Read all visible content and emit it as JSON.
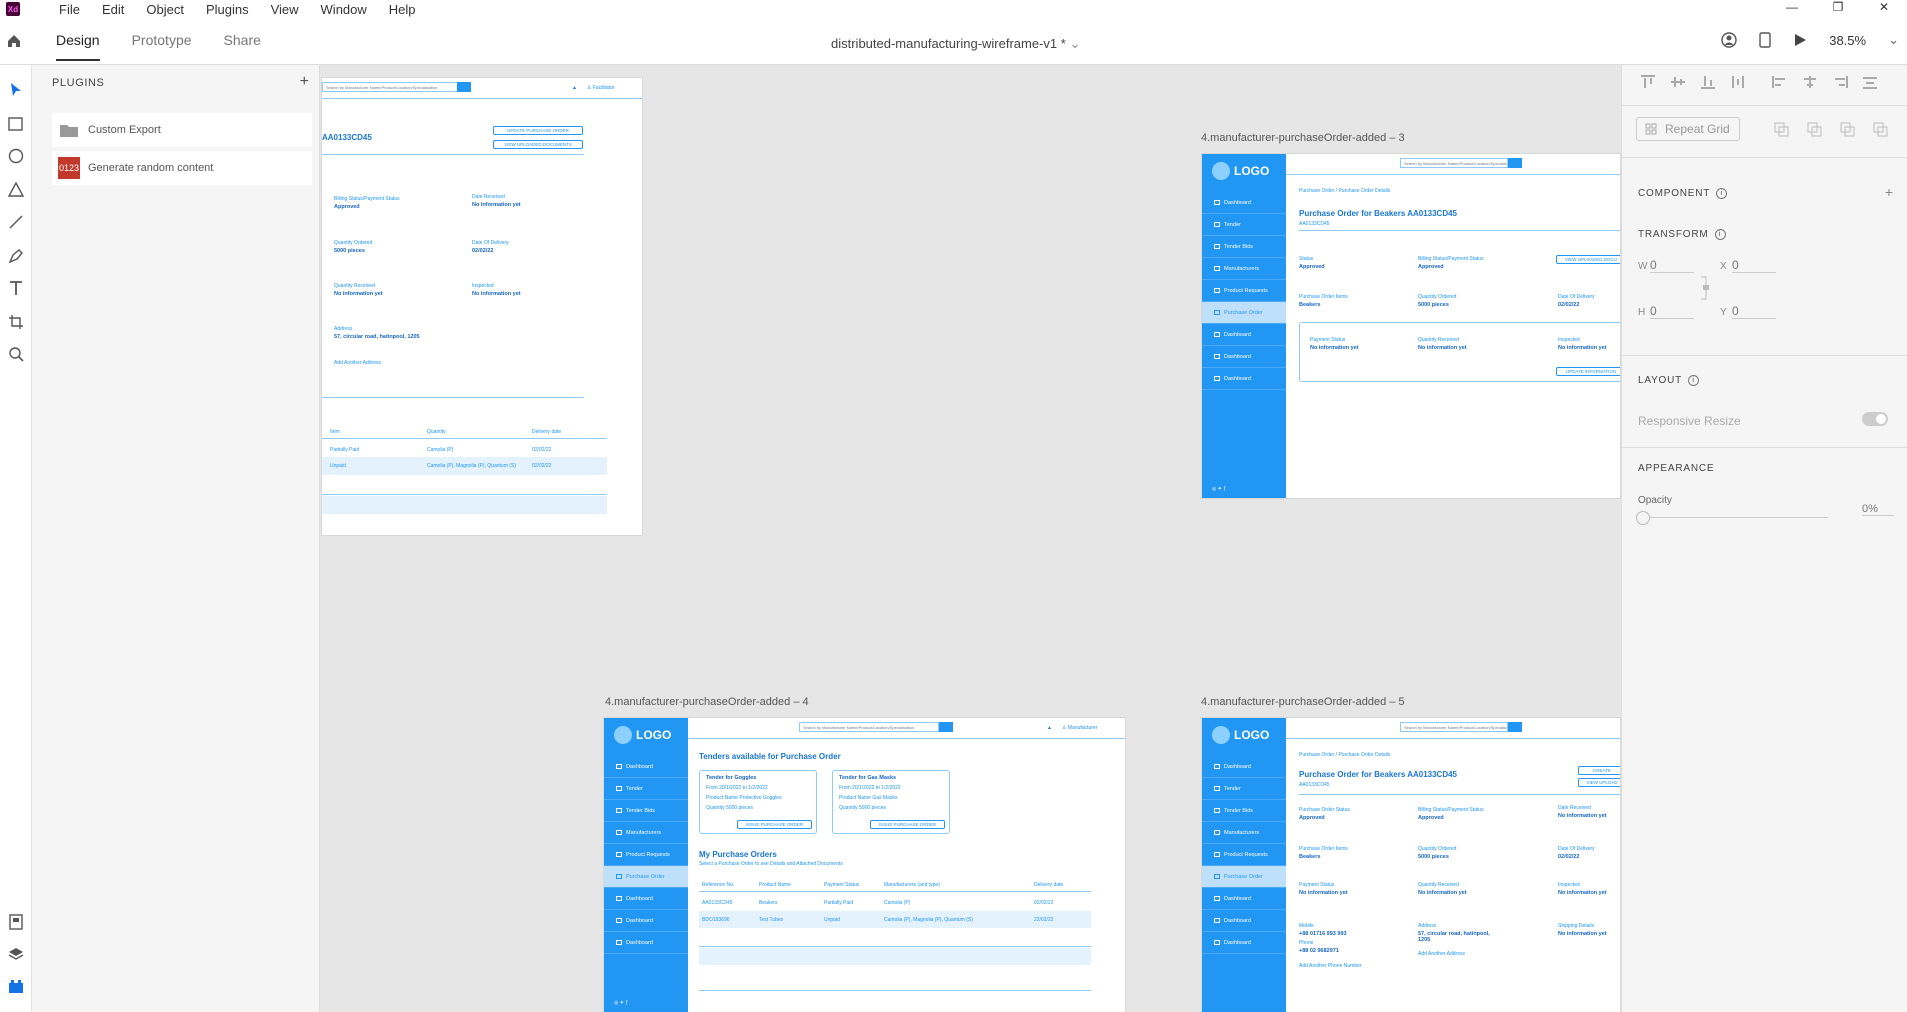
{
  "app": {
    "logo": "Xd",
    "menu": [
      "File",
      "Edit",
      "Object",
      "Plugins",
      "View",
      "Window",
      "Help"
    ],
    "window_controls": [
      "—",
      "❐",
      "✕"
    ]
  },
  "toolbar": {
    "tabs": [
      "Design",
      "Prototype",
      "Share"
    ],
    "document_title": "distributed-manufacturing-wireframe-v1 *",
    "zoom": "38.5%"
  },
  "plugins": {
    "header": "PLUGINS",
    "items": [
      {
        "label": "Custom Export",
        "icon": "folder-icon"
      },
      {
        "label": "Generate random content",
        "icon": "random-content-icon",
        "badge": "0123"
      }
    ]
  },
  "props": {
    "repeat_grid": "Repeat Grid",
    "component": "COMPONENT",
    "transform": "TRANSFORM",
    "w_label": "W",
    "w_value": "0",
    "x_label": "X",
    "x_value": "0",
    "h_label": "H",
    "h_value": "0",
    "y_label": "Y",
    "y_value": "0",
    "layout": "LAYOUT",
    "responsive_resize": "Responsive Resize",
    "appearance": "APPEARANCE",
    "opacity_label": "Opacity",
    "opacity_value": "0%"
  },
  "artboards": {
    "ab1": {
      "search_placeholder": "Search by Manufacturer Name/Product/Location/Specialization",
      "user": "Facilitator",
      "id_title": "AA0133CD45",
      "btn_update": "UPDATE PURCHASE ORDER",
      "btn_view": "VIEW UPLOADED DOCUMENTS",
      "fields": [
        {
          "label": "Billing Status/Payment Status",
          "value": "Approved"
        },
        {
          "label": "Date Received",
          "value": "No information yet"
        },
        {
          "label": "Quantity Ordered",
          "value": "5000 pieces"
        },
        {
          "label": "Date Of Delivery",
          "value": "02/02/22"
        },
        {
          "label": "Quantity Received",
          "value": "No information yet"
        },
        {
          "label": "Inspected",
          "value": "No information yet"
        }
      ],
      "address_label": "Address",
      "address_value": "57, circular road, hatinpool, 1205",
      "add_address": "Add Another Address",
      "table_headers": [
        "Item",
        "Quantity",
        "Delivery date"
      ],
      "rows": [
        [
          "Partially Paid",
          "Camolia (P)",
          "02/02/22"
        ],
        [
          "Unpaid",
          "Camolia (P), Magnolia (P), Quantum (S)",
          "02/02/22"
        ]
      ]
    },
    "ab3": {
      "label": "4.manufacturer-purchaseOrder-added – 3",
      "logo": "LOGO",
      "search_placeholder": "Search by Manufacturer Name/Product/Location/Specialization",
      "nav": [
        "Dashboard",
        "Tender",
        "Tender Bids",
        "Manufacturers",
        "Product Requests",
        "Purchase Order",
        "Dashboard",
        "Dashboard",
        "Dashboard"
      ],
      "breadcrumb": "Purchase Order  /  Purchase Order Details",
      "title": "Purchase Order for Beakers AA0133CD45",
      "subtitle": "AA0133CD45",
      "fields": [
        {
          "label": "Status",
          "value": "Approved"
        },
        {
          "label": "Billing Status/Payment Status",
          "value": "Approved"
        },
        {
          "label": "Purchase Order Items",
          "value": "Beakers"
        },
        {
          "label": "Quantity Ordered",
          "value": "5000 pieces"
        },
        {
          "label": "Date Of Delivery",
          "value": "02/02/22"
        }
      ],
      "box_fields": [
        {
          "label": "Payment Status",
          "value": "No information yet"
        },
        {
          "label": "Quantity Received",
          "value": "No information yet"
        },
        {
          "label": "Inspected",
          "value": "No information yet"
        }
      ],
      "btn_view": "VIEW UPLOADED DOCU",
      "btn_update": "UPDATE INFORMATION"
    },
    "ab4": {
      "label": "4.manufacturer-purchaseOrder-added – 4",
      "logo": "LOGO",
      "search_placeholder": "Search by Manufacturer Name/Product/Location/Specialization",
      "user": "Manufacturer",
      "nav": [
        "Dashboard",
        "Tender",
        "Tender Bids",
        "Manufacturers",
        "Product Requests",
        "Purchase Order",
        "Dashboard",
        "Dashboard",
        "Dashboard"
      ],
      "tenders_title": "Tenders available for Purchase Order",
      "tenders": [
        {
          "title": "Tender for Goggles",
          "from": "From 20/1/2022 to 1/2/2022",
          "product": "Product Name Protective Goggles",
          "qty": "Quantity 5000 pieces",
          "btn": "ISSUE PURCHASE ORDER"
        },
        {
          "title": "Tender for Gas Masks",
          "from": "From 20/1/2022 to 1/2/2022",
          "product": "Product Name Gas Masks",
          "qty": "Quantity 5000 pieces",
          "btn": "ISSUE PURCHASE ORDER"
        }
      ],
      "my_orders_title": "My Purchase Orders",
      "my_orders_sub": "Select a Purchase Order to see Details and Attached Documents",
      "table_headers": [
        "Reference No.",
        "Product Name",
        "Payment Status",
        "Manufacturers (and type)",
        "Delivery date"
      ],
      "rows": [
        [
          "AA0133CD45",
          "Beakers",
          "Partially Paid",
          "Camolia (P)",
          "02/02/22"
        ],
        [
          "BDO193696",
          "Test Tubes",
          "Unpaid",
          "Camolia (P), Magnolia (P), Quantum (S)",
          "22/02/22"
        ]
      ]
    },
    "ab5": {
      "label": "4.manufacturer-purchaseOrder-added – 5",
      "logo": "LOGO",
      "search_placeholder": "Search by Manufacturer Name/Product/Location/Specialization",
      "nav": [
        "Dashboard",
        "Tender",
        "Tender Bids",
        "Manufacturers",
        "Product Requests",
        "Purchase Order",
        "Dashboard",
        "Dashboard",
        "Dashboard"
      ],
      "breadcrumb": "Purchase Order  /  Purchase Order Details",
      "title": "Purchase Order for Beakers AA0133CD45",
      "subtitle": "AA0133CD45",
      "btn_create": "CREATE",
      "btn_view": "VIEW UPLOAD",
      "fields": [
        {
          "label": "Purchase Order Status",
          "value": "Approved"
        },
        {
          "label": "Billing Status/Payment Status",
          "value": "Approved"
        },
        {
          "label": "Date Received",
          "value": "No information yet"
        },
        {
          "label": "Purchase Order Items",
          "value": "Beakers"
        },
        {
          "label": "Quantity Ordered",
          "value": "5000 pieces"
        },
        {
          "label": "Date Of Delivery",
          "value": "02/02/22"
        },
        {
          "label": "Payment Status",
          "value": "No information yet"
        },
        {
          "label": "Quantity Received",
          "value": "No information yet"
        },
        {
          "label": "Inspected",
          "value": "No information yet"
        },
        {
          "label": "Mobile",
          "value": "+88 01716 993 993"
        },
        {
          "label": "Address",
          "value": "57, circular road, hatinpool, 1205"
        },
        {
          "label": "Shipping Details",
          "value": "No information yet"
        }
      ],
      "phone_label": "Phone",
      "phone_value": "+88 02 9682971",
      "add_phone": "Add Another Phone Number",
      "add_address": "Add Another Address"
    }
  }
}
